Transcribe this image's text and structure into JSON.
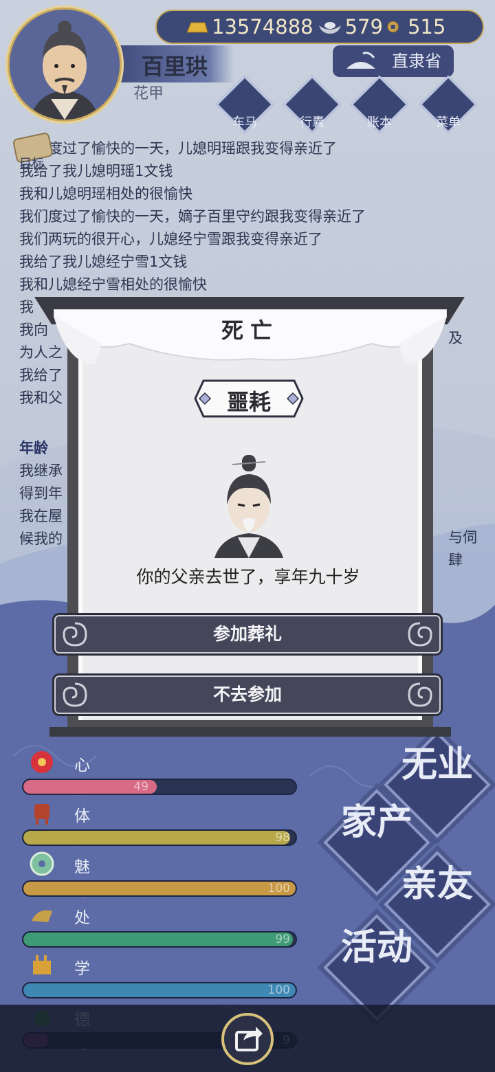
{
  "header": {
    "name": "百里珙",
    "age": "花甲",
    "region": "直隶省",
    "currency": {
      "gold": "13574888",
      "silver": "579",
      "coin": "515"
    },
    "menu": [
      "车马",
      "行囊",
      "账本",
      "菜单"
    ]
  },
  "goal_label": "目标",
  "log": {
    "lines": [
      "我们度过了愉快的一天，儿媳明瑶跟我变得亲近了",
      "我给了我儿媳明瑶1文钱",
      "我和儿媳明瑶相处的很愉快",
      "我们度过了愉快的一天，嫡子百里守约跟我变得亲近了",
      "我们两玩的很开心，儿媳经宁雪跟我变得亲近了",
      "我给了我儿媳经宁雪1文钱",
      "我和儿媳经宁雪相处的很愉快",
      "我",
      "我向",
      "为人之",
      "我给了",
      "我和父"
    ],
    "right_fragment": "及",
    "section": "年龄 ",
    "section_lines": [
      "我继承",
      "得到年",
      "我在屋",
      "候我的"
    ],
    "section_right": [
      "与伺",
      "肆"
    ]
  },
  "stats": [
    {
      "label": "心情",
      "value": "49",
      "level": 0.49,
      "color": "#d86a86"
    },
    {
      "label": "体魄",
      "value": "98",
      "level": 0.98,
      "color": "#b7a94a"
    },
    {
      "label": "魅力",
      "value": "100",
      "level": 1.0,
      "color": "#c89a46"
    },
    {
      "label": "处世",
      "value": "99",
      "level": 0.99,
      "color": "#3f9a76"
    },
    {
      "label": "学识",
      "value": "100",
      "level": 1.0,
      "color": "#3f88b3"
    },
    {
      "label": "德行",
      "value": "9",
      "level": 0.09,
      "color": "#7a3d8a"
    }
  ],
  "big_buttons": [
    "无业",
    "家产",
    "亲友",
    "活动"
  ],
  "modal": {
    "title": "死亡",
    "tag": "噩耗",
    "message": "你的父亲去世了，享年九十岁",
    "attend": "参加葬礼",
    "decline": "不去参加"
  }
}
